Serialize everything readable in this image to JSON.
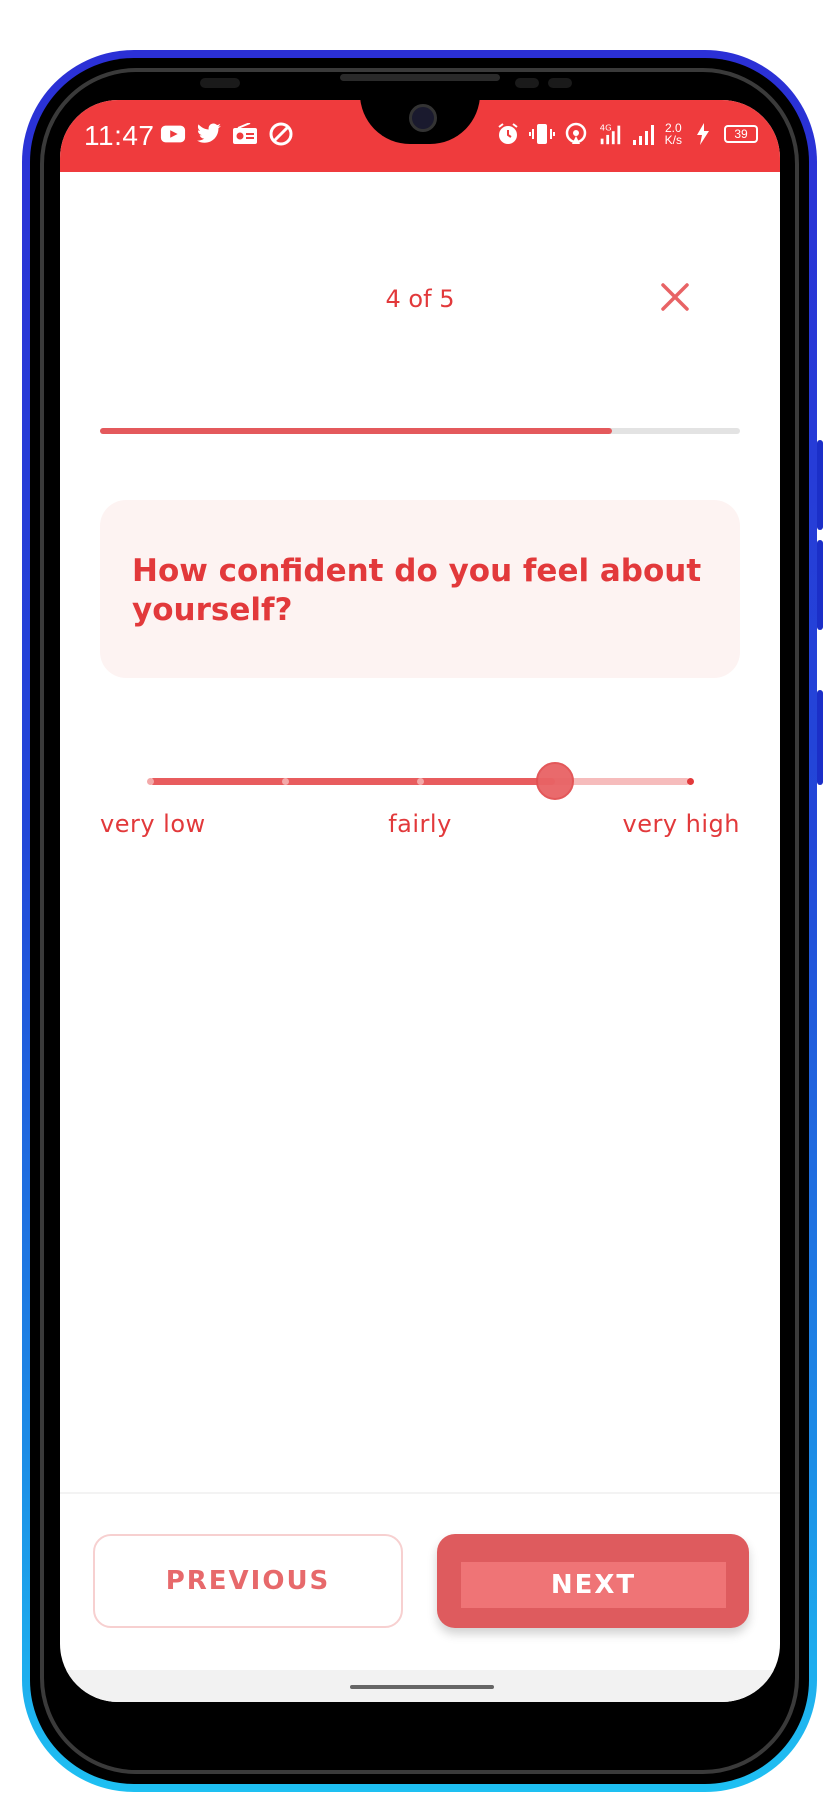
{
  "status_bar": {
    "time": "11:47",
    "left_icons": [
      "youtube-icon",
      "twitter-icon",
      "radio-icon",
      "sync-icon"
    ],
    "right_icons": [
      "alarm-icon",
      "vibrate-icon",
      "hotspot-icon",
      "signal-4g-icon",
      "signal-icon",
      "network-speed",
      "charging-icon",
      "battery-icon"
    ],
    "network_speed_value": "2.0",
    "network_speed_unit": "K/s",
    "battery_level": "39",
    "network_type": "4G",
    "accent_color": "#ef3b3d"
  },
  "survey": {
    "progress_label": "4 of 5",
    "progress_current": 4,
    "progress_total": 5,
    "progress_fill_fraction": 0.8,
    "close_icon": "close-icon",
    "question": "How confident do you feel about yourself?",
    "slider": {
      "steps": 5,
      "selected_index": 3,
      "labels": [
        "very low",
        "fairly",
        "very high"
      ]
    }
  },
  "footer": {
    "previous_label": "PREVIOUS",
    "next_label": "NEXT"
  },
  "colors": {
    "primary": "#e2393b",
    "button_fill": "#de5b5e",
    "card_background": "#fdf3f2"
  }
}
